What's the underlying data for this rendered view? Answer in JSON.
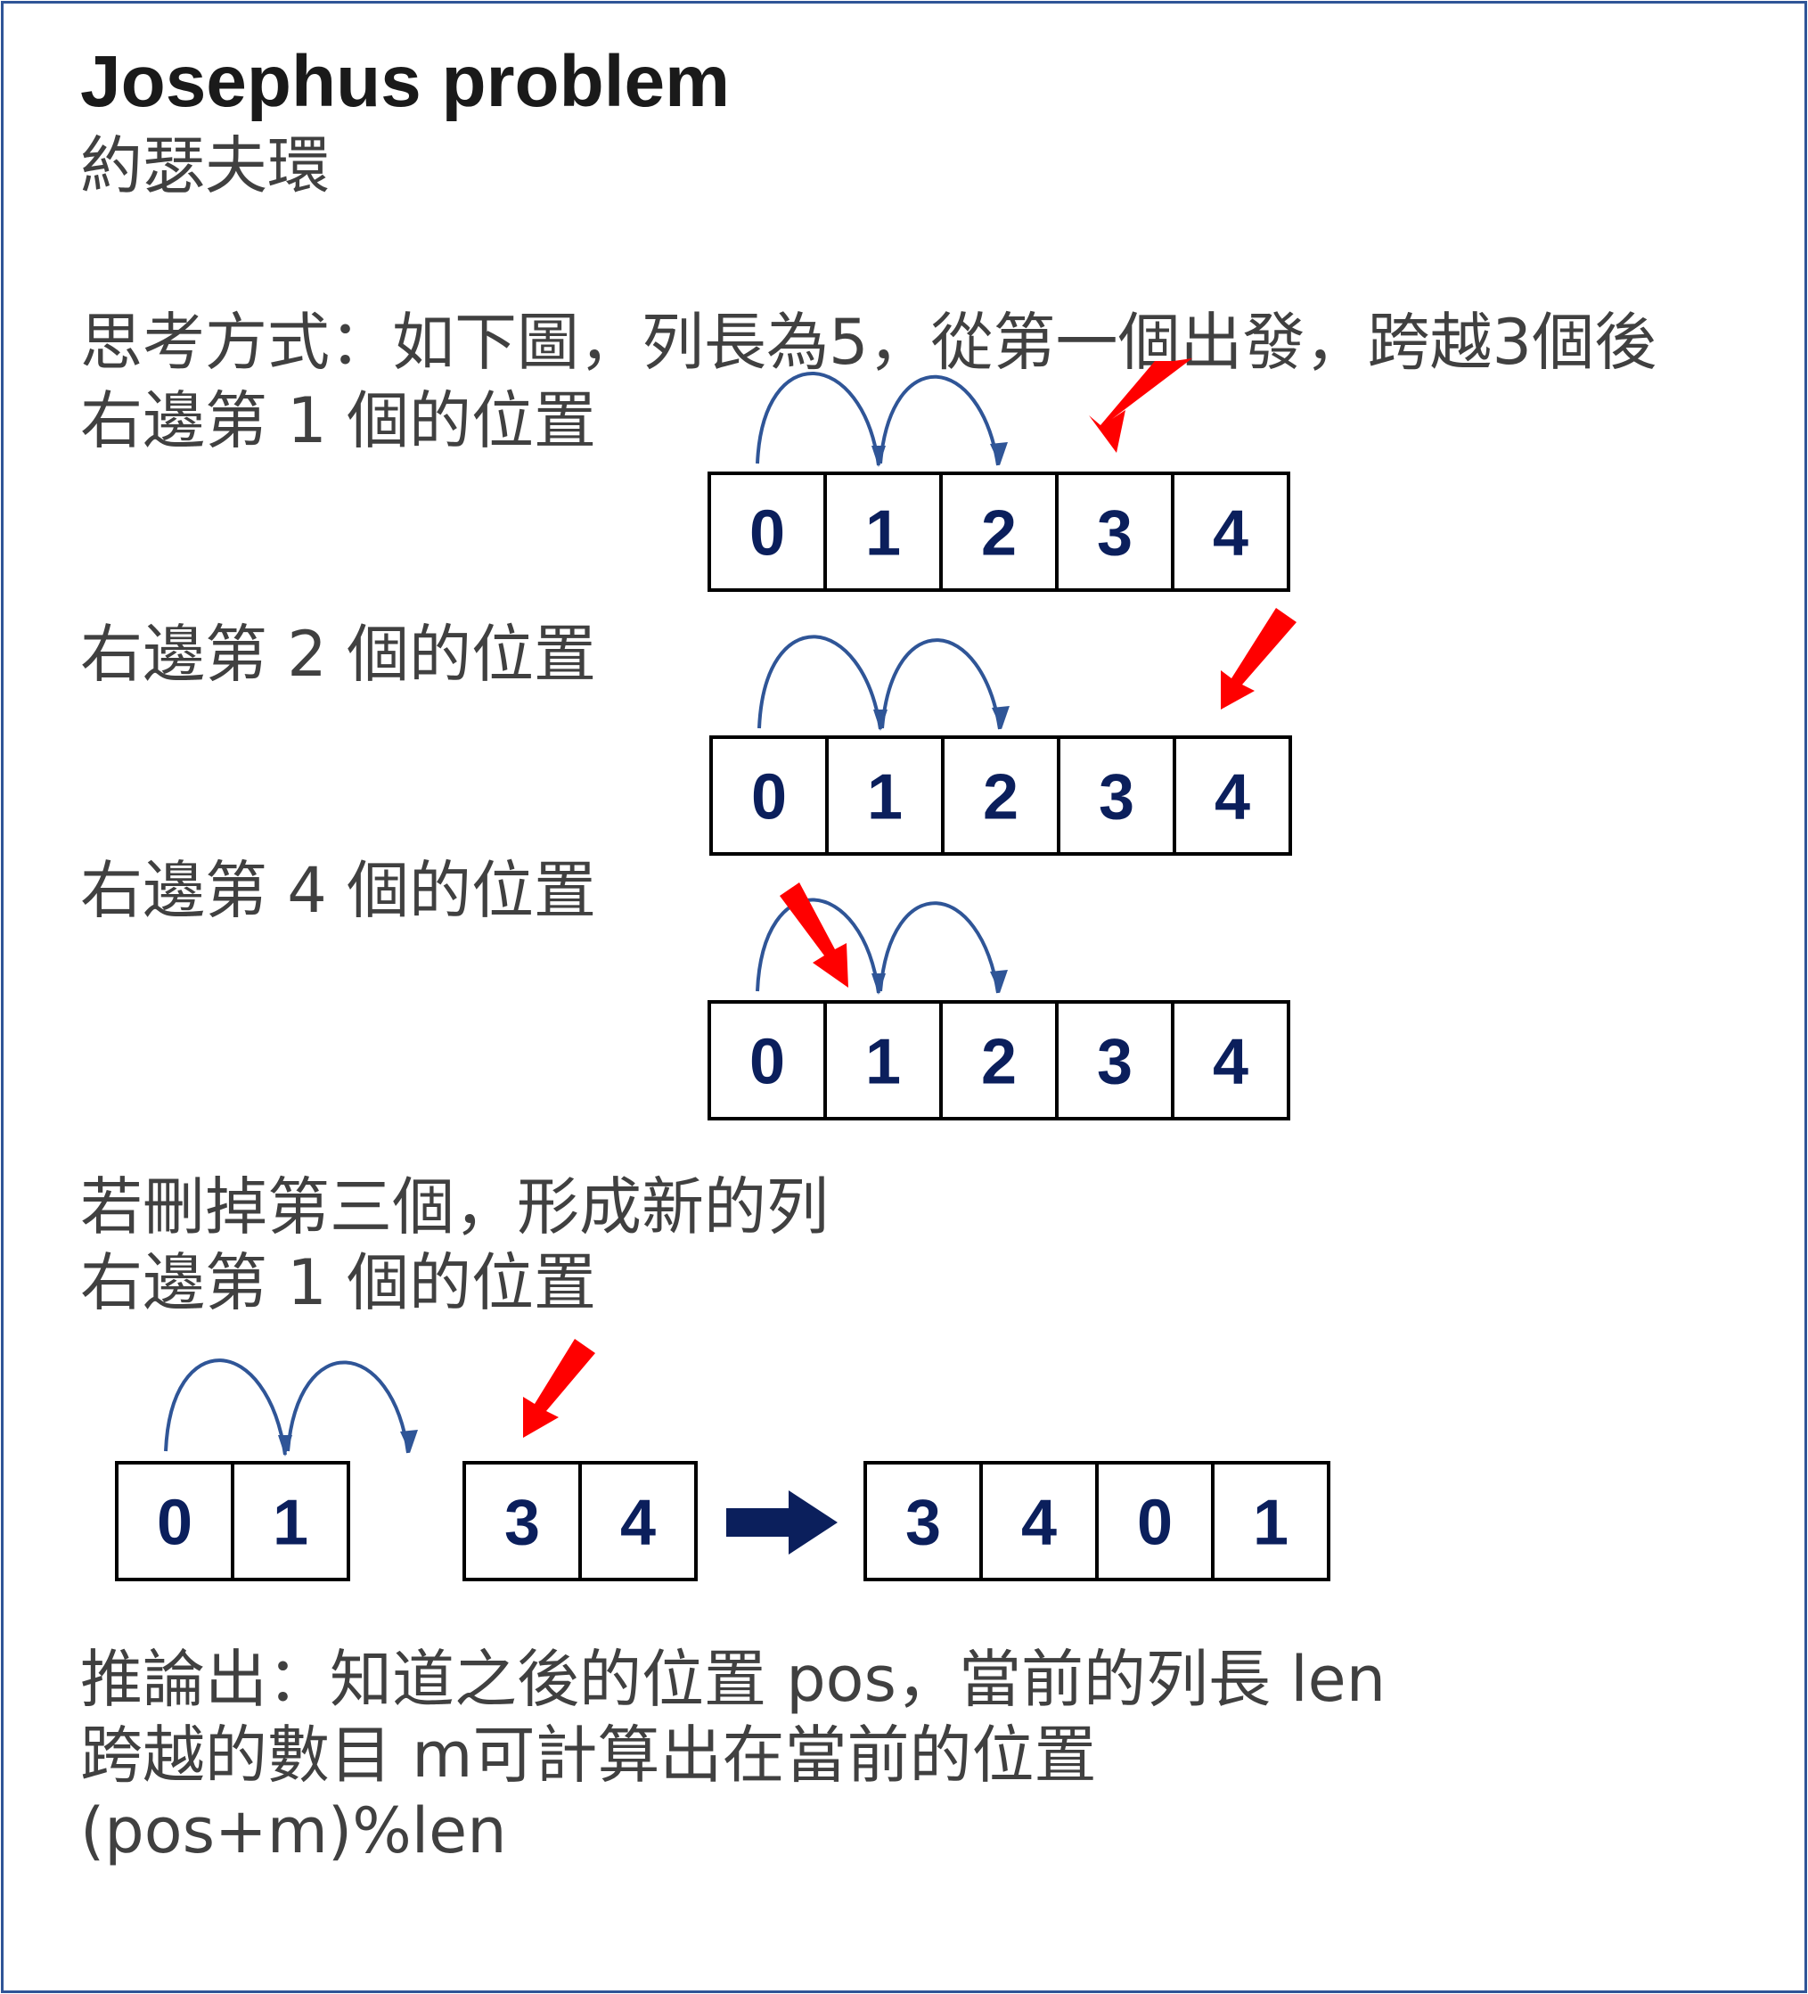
{
  "title": "Josephus problem",
  "subtitle": "約瑟夫環",
  "description": "思考方式：如下圖，列長為5，從第一個出發，跨越3個後",
  "step1_label": "右邊第 1 個的位置",
  "step2_label": "右邊第 2 個的位置",
  "step4_label": "右邊第 4 個的位置",
  "remove_line1": "若刪掉第三個，形成新的列",
  "remove_line2": "右邊第 1 個的位置",
  "conclusion_line1": "推論出：知道之後的位置 pos，當前的列長 len",
  "conclusion_line2": "跨越的數目 m可計算出在當前的位置",
  "formula": "(pos+m)%len",
  "row1_cells": [
    "0",
    "1",
    "2",
    "3",
    "4"
  ],
  "row2_cells": [
    "0",
    "1",
    "2",
    "3",
    "4"
  ],
  "row3_cells": [
    "0",
    "1",
    "2",
    "3",
    "4"
  ],
  "left_group_cells": [
    "0",
    "1"
  ],
  "middle_group_cells": [
    "3",
    "4"
  ],
  "result_cells": [
    "3",
    "4",
    "0",
    "1"
  ],
  "colors": {
    "arc": "#2f5597",
    "pointer": "#ff0000",
    "cell_text": "#0b1f5c",
    "big_arrow": "#0b1f5c",
    "frame": "#2f5597"
  },
  "icons": [
    "hop-arc-icon",
    "pointer-arrow-icon",
    "transform-arrow-icon"
  ]
}
